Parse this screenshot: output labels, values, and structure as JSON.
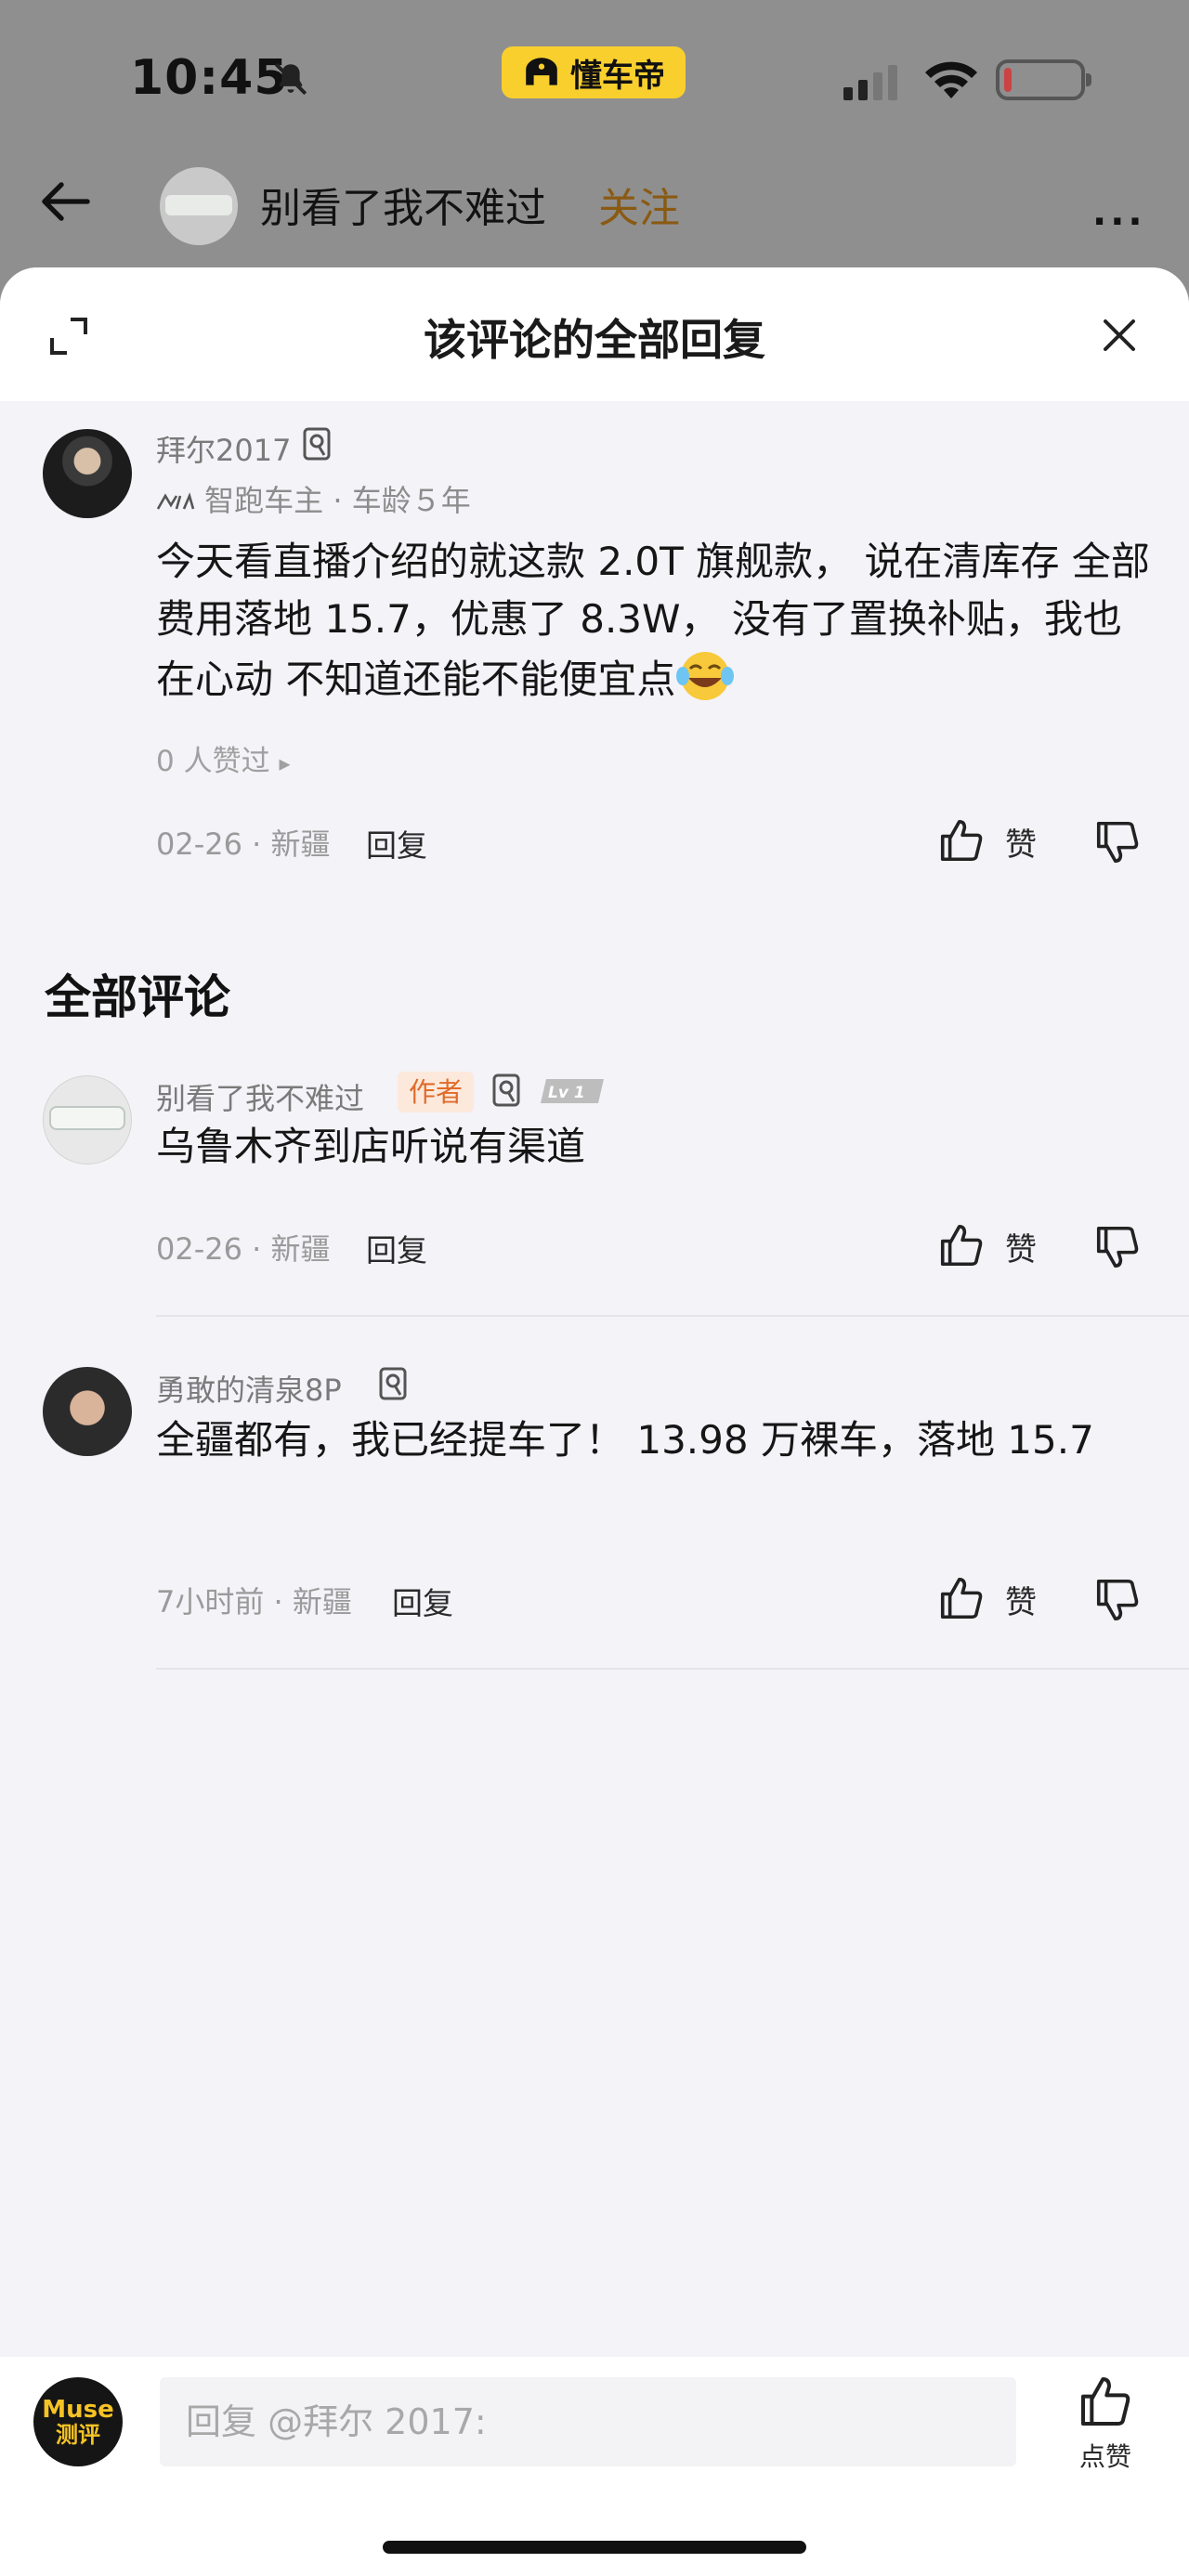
{
  "status_bar": {
    "time": "10:45",
    "app_label": "懂车帝",
    "battery_level": 0.1
  },
  "page_header": {
    "author_name": "别看了我不难过",
    "follow_label": "关注",
    "more_label": "···"
  },
  "sheet": {
    "title": "该评论的全部回复"
  },
  "main_comment": {
    "username": "拜尔2017",
    "owner_info": "智跑车主 · 车龄５年",
    "text": "今天看直播介绍的就这款 2.0T 旗舰款， 说在清库存 全部费用落地 15.7，优惠了 8.3W， 没有了置换补贴，我也在心动 不知道还能不能便宜点",
    "likes_text": "0 人赞过",
    "likes_arrow": "▸",
    "date_location": "02-26 · 新疆",
    "reply_label": "回复",
    "like_label": "赞"
  },
  "all_comments": {
    "title": "全部评论",
    "items": [
      {
        "username": "别看了我不难过",
        "author_tag": "作者",
        "level": "Lv 1",
        "text": "乌鲁木齐到店听说有渠道",
        "date_location": "02-26 · 新疆",
        "reply_label": "回复",
        "like_label": "赞"
      },
      {
        "username": "勇敢的清泉8P",
        "text": "全疆都有，我已经提车了！ 13.98 万裸车，落地 15.7",
        "date_location": "7小时前 · 新疆",
        "reply_label": "回复",
        "like_label": "赞"
      }
    ]
  },
  "bottom_bar": {
    "avatar_text_top": "Muse",
    "avatar_text_bottom": "测评",
    "reply_placeholder": "回复 @拜尔 2017:",
    "like_label": "点赞"
  },
  "colors": {
    "follow": "#8a5a12",
    "author_tag_bg": "#fde9dc",
    "author_tag_text": "#e06b2a",
    "app_pill": "#f9cf2e",
    "battery_low": "#e02a2a"
  }
}
